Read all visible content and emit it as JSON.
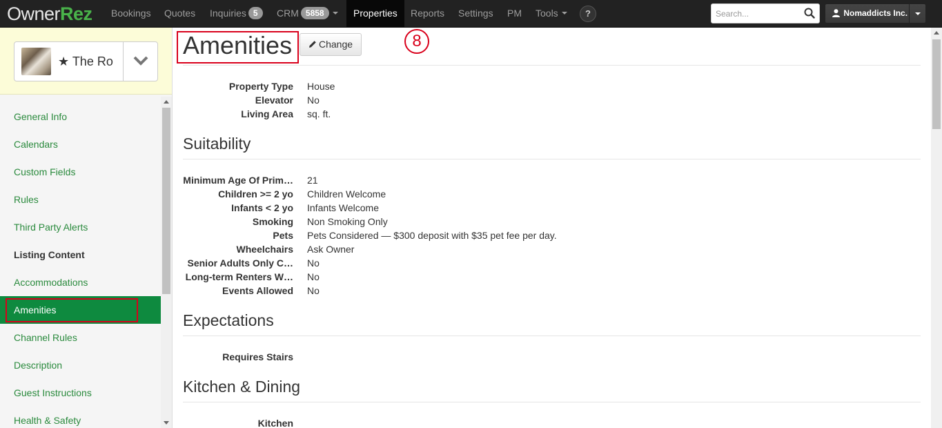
{
  "app": {
    "logo_owner": "Owner",
    "logo_rez": "Rez"
  },
  "nav": {
    "items": [
      {
        "label": "Bookings"
      },
      {
        "label": "Quotes"
      },
      {
        "label": "Inquiries",
        "badge": "5"
      },
      {
        "label": "CRM",
        "badge": "5858"
      },
      {
        "label": "Properties"
      },
      {
        "label": "Reports"
      },
      {
        "label": "Settings"
      },
      {
        "label": "PM"
      },
      {
        "label": "Tools"
      }
    ],
    "help": "?",
    "search_placeholder": "Search...",
    "user": "Nomaddicts Inc."
  },
  "property": {
    "name": "★ The Ro"
  },
  "sidebar": {
    "items": [
      {
        "label": "General Info"
      },
      {
        "label": "Calendars"
      },
      {
        "label": "Custom Fields"
      },
      {
        "label": "Rules"
      },
      {
        "label": "Third Party Alerts"
      },
      {
        "label": "Listing Content"
      },
      {
        "label": "Accommodations"
      },
      {
        "label": "Amenities"
      },
      {
        "label": "Channel Rules"
      },
      {
        "label": "Description"
      },
      {
        "label": "Guest Instructions"
      },
      {
        "label": "Health & Safety"
      }
    ]
  },
  "main": {
    "title": "Amenities",
    "change_label": "Change",
    "step_number": "8",
    "general": [
      {
        "label": "Property Type",
        "value": "House"
      },
      {
        "label": "Elevator",
        "value": "No"
      },
      {
        "label": "Living Area",
        "value": "sq. ft."
      }
    ],
    "suitability": {
      "title": "Suitability",
      "rows": [
        {
          "label": "Minimum Age Of Prim…",
          "value": "21"
        },
        {
          "label": "Children >= 2 yo",
          "value": "Children Welcome"
        },
        {
          "label": "Infants < 2 yo",
          "value": "Infants Welcome"
        },
        {
          "label": "Smoking",
          "value": "Non Smoking Only"
        },
        {
          "label": "Pets",
          "value": "Pets Considered — $300 deposit with $35 pet fee per day."
        },
        {
          "label": "Wheelchairs",
          "value": "Ask Owner"
        },
        {
          "label": "Senior Adults Only C…",
          "value": "No"
        },
        {
          "label": "Long-term Renters W…",
          "value": "No"
        },
        {
          "label": "Events Allowed",
          "value": "No"
        }
      ]
    },
    "expectations": {
      "title": "Expectations",
      "rows": [
        {
          "label": "Requires Stairs",
          "value": ""
        }
      ]
    },
    "kitchen": {
      "title": "Kitchen & Dining",
      "rows": [
        {
          "label": "Kitchen",
          "value": ""
        }
      ]
    }
  },
  "colors": {
    "brand_green": "#49b24a",
    "active_menu": "#0e8a3f",
    "link_green": "#2a8a3d",
    "highlight_red": "#d9001b"
  }
}
